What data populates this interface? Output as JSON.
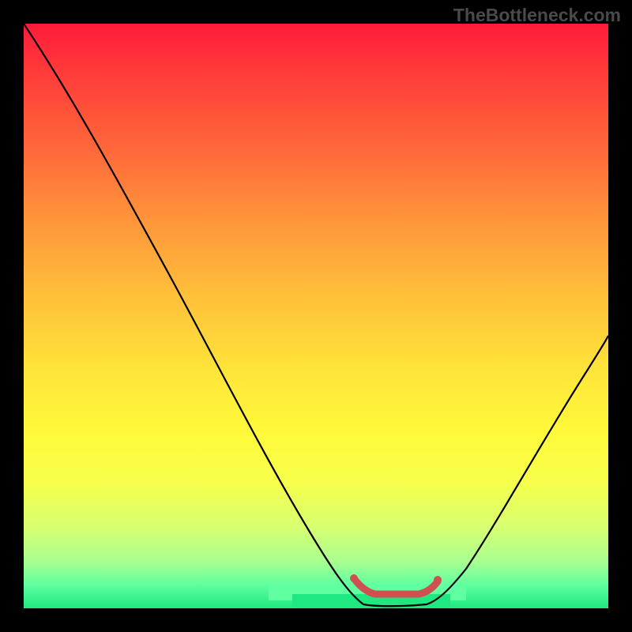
{
  "watermark": "TheBottleneck.com",
  "chart_data": {
    "type": "line",
    "title": "",
    "xlabel": "",
    "ylabel": "",
    "xlim": [
      0,
      100
    ],
    "ylim": [
      0,
      100
    ],
    "annotations": [],
    "series": [
      {
        "name": "curve",
        "x": [
          0,
          5,
          10,
          15,
          20,
          25,
          30,
          35,
          40,
          45,
          50,
          55,
          58,
          60,
          62,
          65,
          68,
          70,
          72,
          75,
          80,
          85,
          90,
          95,
          100
        ],
        "values": [
          100,
          94,
          88,
          82,
          75,
          67,
          59,
          50,
          40,
          30,
          21,
          12,
          8,
          6,
          4,
          2,
          1,
          1,
          2,
          5,
          11,
          18,
          26,
          34,
          42
        ]
      }
    ],
    "highlight_range": {
      "name": "optimal-zone",
      "x_start": 58,
      "x_end": 72,
      "y": 5,
      "color": "#d05050"
    }
  }
}
